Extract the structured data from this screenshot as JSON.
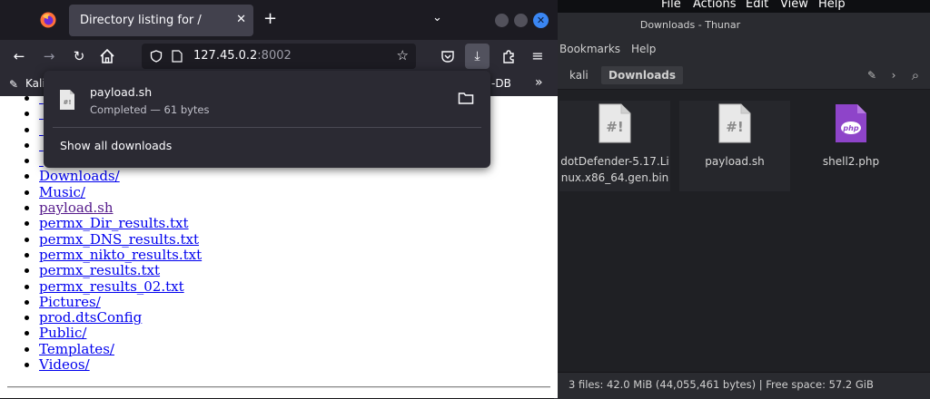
{
  "thunar": {
    "menubar": [
      "File",
      "Actions",
      "Edit",
      "View",
      "Help"
    ],
    "title": "Downloads - Thunar",
    "menu2": [
      "Bookmarks",
      "Help"
    ],
    "breadcrumbs": [
      "kali",
      "Downloads"
    ],
    "files": [
      {
        "name": "dotDefender-5.17.Linux.x86_64.gen.bin",
        "icon": "script-file-icon",
        "selected": true
      },
      {
        "name": "payload.sh",
        "icon": "script-file-icon",
        "selected": true
      },
      {
        "name": "shell2.php",
        "icon": "php-file-icon",
        "selected": false
      }
    ],
    "status": "3 files: 42.0 MiB (44,055,461 bytes) | Free space: 57.2 GiB"
  },
  "firefox": {
    "tab_title": "Directory listing for /",
    "url_host": "127.45.0.2",
    "url_port": ":8002",
    "bookmarks": [
      "Kali",
      "-DB"
    ],
    "listing": [
      {
        "name": "Downloads/",
        "visited": false
      },
      {
        "name": "Music/",
        "visited": false
      },
      {
        "name": "payload.sh",
        "visited": true
      },
      {
        "name": "permx_Dir_results.txt",
        "visited": false
      },
      {
        "name": "permx_DNS_results.txt",
        "visited": false
      },
      {
        "name": "permx_nikto_results.txt",
        "visited": false
      },
      {
        "name": "permx_results.txt",
        "visited": false
      },
      {
        "name": "permx_results_02.txt",
        "visited": false
      },
      {
        "name": "Pictures/",
        "visited": false
      },
      {
        "name": "prod.dtsConfig",
        "visited": false
      },
      {
        "name": "Public/",
        "visited": false
      },
      {
        "name": "Templates/",
        "visited": false
      },
      {
        "name": "Videos/",
        "visited": false
      }
    ],
    "downloads_panel": {
      "file_name": "payload.sh",
      "file_status": "Completed — 61 bytes",
      "show_all": "Show all downloads"
    }
  },
  "colors": {
    "link": "#0000ee",
    "visited": "#551a8b",
    "ff_dark": "#2b2a33",
    "thunar_bg": "#1f2024",
    "php_purple": "#8e44c9"
  }
}
